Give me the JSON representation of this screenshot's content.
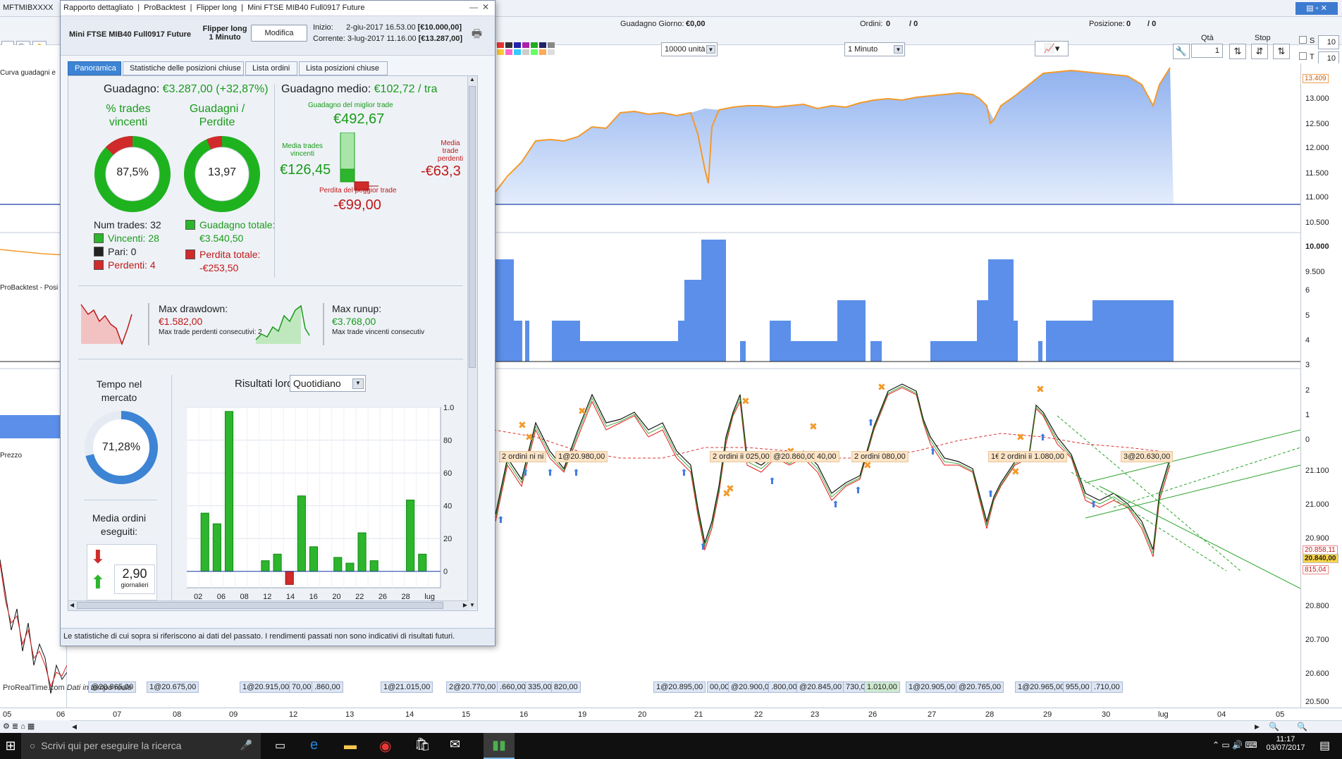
{
  "app": {
    "symbol": "MFTMIBXXXX",
    "guadagno_giorno_label": "Guadagno Giorno:",
    "guadagno_giorno": "€0,00",
    "ordini_label": "Ordini:",
    "ordini": "0",
    "ordini2": "/ 0",
    "posizione_label": "Posizione:",
    "posizione": "0",
    "posizione2": "/ 0",
    "qta_label": "Qtà",
    "qta_value": "1",
    "stop_label": "Stop",
    "s_label": "S",
    "s_value": "10",
    "t_label": "T",
    "t_value": "10",
    "units_select": "10000 unità",
    "timeframe_select": "1 Minuto"
  },
  "panels": {
    "equity": "Curva guadagni e",
    "positions": "ProBacktest - Posi",
    "price": "Prezzo"
  },
  "dialog": {
    "title_items": [
      "Rapporto dettagliato",
      "ProBacktest",
      "Flipper long",
      "Mini FTSE MIB40 Full0917 Future"
    ],
    "instrument": "Mini FTSE MIB40 Full0917 Future",
    "strategy_line1": "Flipper long",
    "strategy_line2": "1 Minuto",
    "modify_button": "Modifica",
    "start_label": "Inizio:",
    "start_value": "2-giu-2017 16.53.00",
    "start_capital": "[€10.000,00]",
    "current_label": "Corrente:",
    "current_value": "3-lug-2017 11.16.00",
    "current_capital": "[€13.287,00]",
    "tabs": [
      "Panoramica",
      "Statistiche delle posizioni chiuse",
      "Lista ordini",
      "Lista posizioni chiuse"
    ],
    "gain_label": "Guadagno:",
    "gain_value": "€3.287,00 (+32,87%)",
    "pct_win_label1": "% trades",
    "pct_win_label2": "vincenti",
    "pct_win_value": "87,5%",
    "pct_win_fraction": 0.875,
    "gl_label1": "Guadagni /",
    "gl_label2": "Perdite",
    "gl_value": "13,97",
    "gl_fraction": 0.933,
    "num_trades": "Num trades: 32",
    "winners": "Vincenti: 28",
    "pari": "Pari: 0",
    "losers": "Perdenti: 4",
    "total_gain_label": "Guadagno totale:",
    "total_gain": "€3.540,50",
    "total_loss_label": "Perdita totale:",
    "total_loss": "-€253,50",
    "avg_gain_label": "Guadagno medio:",
    "avg_gain_value": "€102,72 / tra",
    "best_trade_label": "Guadagno del miglior trade",
    "best_trade_value": "€492,67",
    "avg_win_label1": "Media trades",
    "avg_win_label2": "vincenti",
    "avg_win_value": "€126,45",
    "avg_loss_label1": "Media trade",
    "avg_loss_label2": "perdenti",
    "avg_loss_value": "-€63,3",
    "worst_trade_label": "Perdita del peggior trade",
    "worst_trade_value": "-€99,00",
    "max_dd_label": "Max drawdown:",
    "max_dd_value": "€1.582,00",
    "max_dd_sub": "Max trade perdenti consecutivi:  2",
    "max_ru_label": "Max runup:",
    "max_ru_value": "€3.768,00",
    "max_ru_sub": "Max trade vincenti consecutiv",
    "time_label1": "Tempo nel",
    "time_label2": "mercato",
    "time_value": "71,28%",
    "time_fraction": 0.7128,
    "orders_label1": "Media ordini",
    "orders_label2": "eseguiti:",
    "orders_value": "2,90",
    "orders_unit": "giornalieri",
    "results_label": "Risultati lordi",
    "results_select": "Quotidiano",
    "footer": "Le statistiche di cui sopra si riferiscono ai dati del passato. I rendimenti passati non sono indicativi di risultati futuri."
  },
  "chart_data": {
    "type": "bar",
    "title": "Risultati lordi",
    "categories": [
      "02",
      "05",
      "06",
      "07",
      "08",
      "09",
      "12",
      "13",
      "14",
      "15",
      "16",
      "19",
      "20",
      "21",
      "22",
      "23",
      "26",
      "27",
      "28",
      "29",
      "30"
    ],
    "values": [
      0,
      355,
      290,
      975,
      0,
      0,
      65,
      105,
      -80,
      460,
      150,
      0,
      85,
      50,
      235,
      65,
      0,
      0,
      435,
      105,
      0
    ],
    "xticks": [
      "02",
      "06",
      "08",
      "12",
      "14",
      "16",
      "20",
      "22",
      "26",
      "28",
      "lug"
    ],
    "yticks": [
      "0",
      "20",
      "40",
      "60",
      "80",
      "1.0"
    ],
    "ylim": [
      -100,
      1000
    ]
  },
  "axes": {
    "equity": [
      "13.409",
      "13.000",
      "12.500",
      "12.000",
      "11.500",
      "11.000",
      "10.500",
      "10.000",
      "9.500"
    ],
    "positions": [
      "6",
      "5",
      "4",
      "3",
      "2",
      "1",
      "0"
    ],
    "price": [
      "21.100",
      "21.000",
      "20.900",
      "20.840,00",
      "20.800",
      "20.700",
      "20.600",
      "20.500"
    ],
    "price_highlights": [
      "20.858,11",
      "815,04"
    ],
    "dates": [
      "05",
      "06",
      "07",
      "08",
      "09",
      "12",
      "13",
      "14",
      "15",
      "16",
      "19",
      "20",
      "21",
      "22",
      "23",
      "26",
      "27",
      "28",
      "29",
      "30",
      "lug",
      "04",
      "05"
    ]
  },
  "order_tags_top": [
    "2 ordini ni ni",
    "1@20.980,00",
    "2 ordini ii 025,00",
    "@20.860,00",
    "40,00",
    "2 ordini 080,00",
    "1€",
    "2 ordini ii 1.080,00",
    "3@20.630,00"
  ],
  "order_tags_bottom": [
    "@20.865,00",
    "1@20.675,00",
    "1@20.915,00",
    "70,00",
    ".860,00",
    "1@21.015,00",
    "2@20.770,00",
    ".660,00",
    "335,00",
    "820,00",
    "1@20.895,00",
    "00,00",
    "@20.900,00",
    ".800,00",
    "@20.845,00",
    "730,00",
    "1.010,00",
    "1@20.905,00",
    "@20.765,00",
    "1@20.965,00",
    "955,00",
    ".710,00"
  ],
  "brand": "ProRealTime.com",
  "brand2": "Dati in tempo reale",
  "taskbar": {
    "search": "Scrivi qui per eseguire la ricerca",
    "time": "11:17",
    "date": "03/07/2017"
  }
}
